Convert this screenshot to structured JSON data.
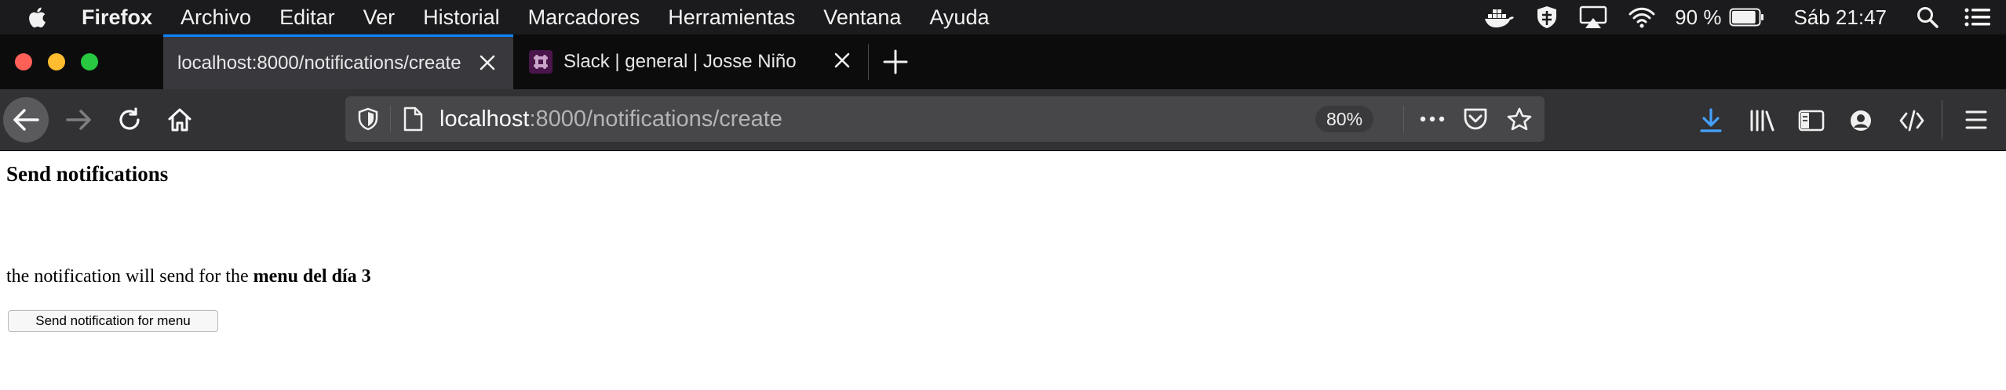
{
  "menubar": {
    "app_name": "Firefox",
    "items": [
      "Archivo",
      "Editar",
      "Ver",
      "Historial",
      "Marcadores",
      "Herramientas",
      "Ventana",
      "Ayuda"
    ],
    "battery_text": "90 %",
    "battery_level": 0.9,
    "clock": "Sáb 21:47"
  },
  "tabs": [
    {
      "label": "localhost:8000/notifications/create",
      "active": true
    },
    {
      "label": "Slack | general | Josse Niño",
      "active": false
    }
  ],
  "address_bar": {
    "host": "localhost",
    "path": ":8000/notifications/create",
    "zoom": "80%"
  },
  "page": {
    "heading": "Send notifications",
    "message_prefix": "the notification will send for the ",
    "message_bold": "menu del día 3",
    "button_label": "Send notification for menu"
  },
  "colors": {
    "menubar_bg": "#1b1b1d",
    "tabstrip_bg": "#0c0c0d",
    "active_tab_bg": "#38383d",
    "toolbar_bg": "#323234",
    "urlbar_bg": "#474749",
    "accent_blue": "#0a84ff",
    "traffic_red": "#fe5f57",
    "traffic_yellow": "#febc2e",
    "traffic_green": "#28c840"
  }
}
